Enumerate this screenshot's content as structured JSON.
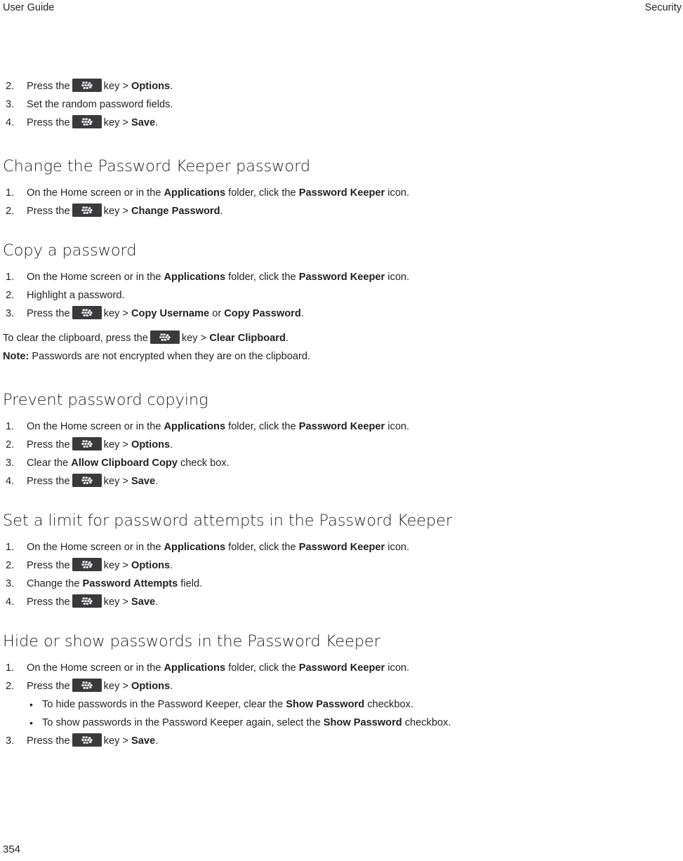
{
  "header": {
    "left": "User Guide",
    "right": "Security"
  },
  "footer": {
    "page_number": "354"
  },
  "icons": {
    "menu_key": "blackberry-menu-key-icon"
  },
  "colors": {
    "text": "#231f20",
    "menu_key_background": "#3a3a3c",
    "menu_key_glyph": "#ffffff",
    "page_background": "#ffffff"
  },
  "continued_list": {
    "items": [
      {
        "num": "2.",
        "pre": "Press the",
        "mid": "key >",
        "bold": "Options",
        "post": "."
      },
      {
        "num": "3.",
        "plain": "Set the random password fields."
      },
      {
        "num": "4.",
        "pre": "Press the",
        "mid": "key >",
        "bold": "Save",
        "post": "."
      }
    ]
  },
  "sections": [
    {
      "title": "Change the Password Keeper password",
      "steps": [
        {
          "num": "1.",
          "pre": "On the Home screen or in the",
          "bold": "Applications",
          "mid2": "folder, click the",
          "bold2": "Password Keeper",
          "post": "icon."
        },
        {
          "num": "2.",
          "pre": "Press the",
          "mid": "key >",
          "bold": "Change Password",
          "post": "."
        }
      ]
    },
    {
      "title": "Copy a password",
      "steps": [
        {
          "num": "1.",
          "pre": "On the Home screen or in the",
          "bold": "Applications",
          "mid2": "folder, click the",
          "bold2": "Password Keeper",
          "post": "icon."
        },
        {
          "num": "2.",
          "plain": "Highlight a password."
        },
        {
          "num": "3.",
          "pre": "Press the",
          "mid": "key >",
          "bold": "Copy Username",
          "conj": "or",
          "bold2": "Copy Password",
          "post": "."
        }
      ],
      "paragraphs": [
        {
          "pre": "To clear the clipboard, press the",
          "mid": "key >",
          "bold": "Clear Clipboard",
          "post": "."
        },
        {
          "bold_lead": "Note:",
          "plain": "Passwords are not encrypted when they are on the clipboard."
        }
      ]
    },
    {
      "title": "Prevent password copying",
      "steps": [
        {
          "num": "1.",
          "pre": "On the Home screen or in the",
          "bold": "Applications",
          "mid2": "folder, click the",
          "bold2": "Password Keeper",
          "post": "icon."
        },
        {
          "num": "2.",
          "pre": "Press the",
          "mid": "key >",
          "bold": "Options",
          "post": "."
        },
        {
          "num": "3.",
          "pre_plain": "Clear the",
          "bold": "Allow Clipboard Copy",
          "post": "check box."
        },
        {
          "num": "4.",
          "pre": "Press the",
          "mid": "key >",
          "bold": "Save",
          "post": "."
        }
      ]
    },
    {
      "title": "Set a limit for password attempts in the Password Keeper",
      "steps": [
        {
          "num": "1.",
          "pre": "On the Home screen or in the",
          "bold": "Applications",
          "mid2": "folder, click the",
          "bold2": "Password Keeper",
          "post": "icon."
        },
        {
          "num": "2.",
          "pre": "Press the",
          "mid": "key >",
          "bold": "Options",
          "post": "."
        },
        {
          "num": "3.",
          "pre_plain": "Change the",
          "bold": "Password Attempts",
          "post": "field."
        },
        {
          "num": "4.",
          "pre": "Press the",
          "mid": "key >",
          "bold": "Save",
          "post": "."
        }
      ]
    },
    {
      "title": "Hide or show passwords in the Password Keeper",
      "steps": [
        {
          "num": "1.",
          "pre": "On the Home screen or in the",
          "bold": "Applications",
          "mid2": "folder, click the",
          "bold2": "Password Keeper",
          "post": "icon."
        },
        {
          "num": "2.",
          "pre": "Press the",
          "mid": "key >",
          "bold": "Options",
          "post": "."
        },
        {
          "num": "3.",
          "pre": "Press the",
          "mid": "key >",
          "bold": "Save",
          "post": "."
        }
      ],
      "subbullets": [
        {
          "dot": "•",
          "pre": "To hide passwords in the Password Keeper, clear the",
          "bold": "Show Password",
          "post": "checkbox."
        },
        {
          "dot": "•",
          "pre": "To show passwords in the Password Keeper again, select the",
          "bold": "Show Password",
          "post": "checkbox."
        }
      ]
    }
  ]
}
